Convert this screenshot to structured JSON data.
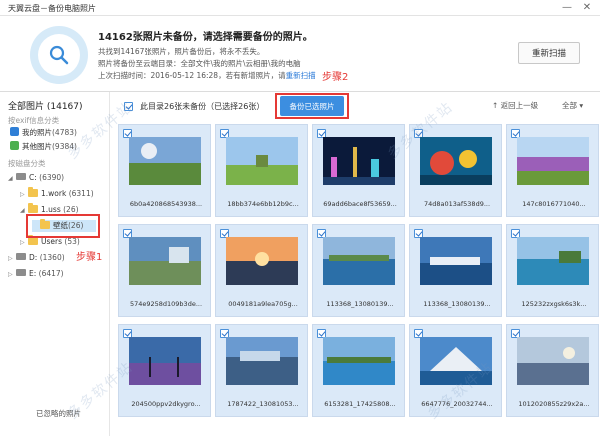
{
  "window": {
    "title": "天翼云盘－备份电脑照片",
    "min": "—",
    "close": "✕"
  },
  "header": {
    "headline": "14162张照片未备份，请选择需要备份的照片。",
    "line1": "共找到14167张照片，照片备份后，将永不丢失。",
    "line2": "照片将备份至云端目录：全部文件\\我的照片\\云相册\\我的电脑",
    "line3_prefix": "上次扫描时间：2016-05-12 16:28，若有新增照片，请",
    "line3_link": "重新扫描",
    "rescan_label": "重新扫描"
  },
  "sidebar": {
    "total": "全部图片 (14167)",
    "exif_section": "按exif信息分类",
    "my_photos": "我的照片",
    "my_photos_count": "(4783)",
    "other_photos": "其他图片",
    "other_photos_count": "(9384)",
    "disk_section": "按磁盘分类",
    "drive_c": "C:",
    "drive_c_count": "(6390)",
    "folder_work": "1.work",
    "folder_work_count": "(6311)",
    "folder_uss": "1.uss",
    "folder_uss_count": "(26)",
    "folder_wallpaper": "壁纸",
    "folder_wallpaper_count": "(26)",
    "folder_users": "Users",
    "folder_users_count": "(53)",
    "drive_d": "D:",
    "drive_d_count": "(1360)",
    "drive_e": "E:",
    "drive_e_count": "(6417)",
    "bottom_note": "已忽略的照片"
  },
  "toolbar": {
    "selection_text": "此目录26张未备份（已选择26张）",
    "backup_button": "备份已选照片",
    "up_level": "返回上一级",
    "select_all": "全部"
  },
  "annotations": {
    "step1": "步骤1",
    "step2": "步骤2"
  },
  "watermark": "多多软件站",
  "photos": [
    {
      "caption": "6b0a420868543938..."
    },
    {
      "caption": "18bb374e6bb12b9c..."
    },
    {
      "caption": "69add6bace8f53659..."
    },
    {
      "caption": "74d8a013af538d9..."
    },
    {
      "caption": "147c8016771040..."
    },
    {
      "caption": "574e9258d109b3de..."
    },
    {
      "caption": "0049181a9lea705g..."
    },
    {
      "caption": "113368_13080139..."
    },
    {
      "caption": "113368_13080139..."
    },
    {
      "caption": "125232zxgsk6s3k..."
    },
    {
      "caption": "204500ppv2dkygro..."
    },
    {
      "caption": "1787422_13081053..."
    },
    {
      "caption": "6153281_17425808..."
    },
    {
      "caption": "6647776_20032744..."
    },
    {
      "caption": "1012020855z29x2a..."
    }
  ]
}
